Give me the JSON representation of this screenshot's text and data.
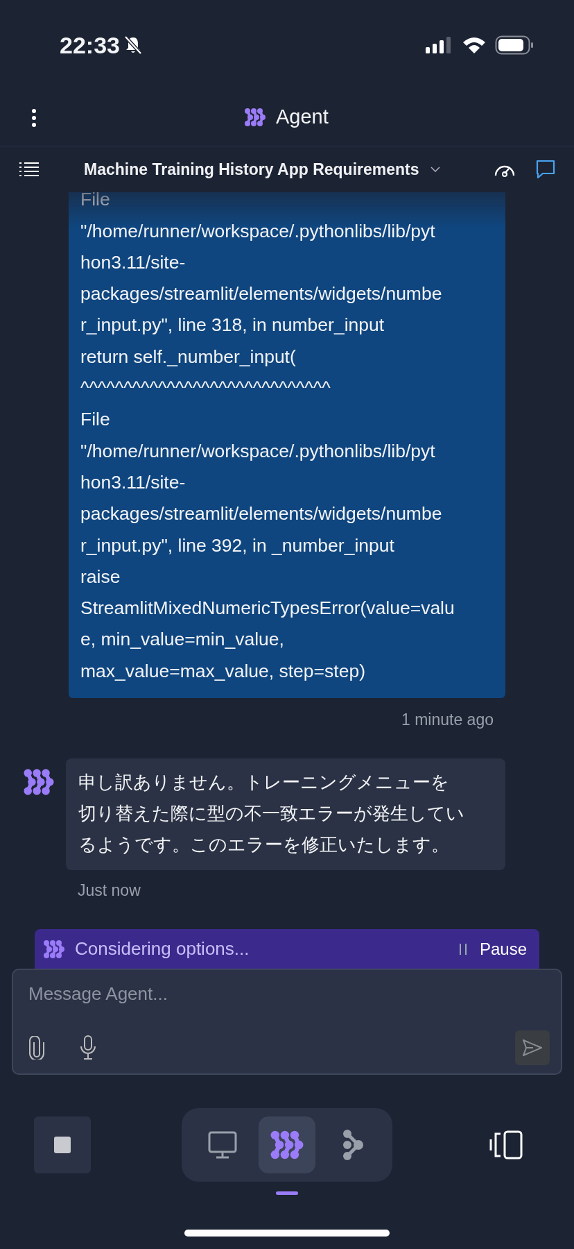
{
  "status_bar": {
    "time": "22:33"
  },
  "header": {
    "title": "Agent"
  },
  "chat": {
    "title": "Machine Training History App Requirements"
  },
  "messages": [
    {
      "kind": "user",
      "lines": [
        "File",
        "\"/home/runner/workspace/.pythonlibs/lib/pyt",
        "hon3.11/site-",
        "packages/streamlit/elements/widgets/numbe",
        "r_input.py\", line 318, in number_input",
        "return self._number_input(",
        "^^^^^^^^^^^^^^^^^^^^^^^^^^^^^",
        "File",
        "\"/home/runner/workspace/.pythonlibs/lib/pyt",
        "hon3.11/site-",
        "packages/streamlit/elements/widgets/numbe",
        "r_input.py\", line 392, in _number_input",
        "raise",
        "StreamlitMixedNumericTypesError(value=valu",
        "e, min_value=min_value,",
        "max_value=max_value, step=step)"
      ],
      "time": "1 minute ago"
    },
    {
      "kind": "agent",
      "text": "申し訳ありません。トレーニングメニューを切り替えた際に型の不一致エラーが発生しているようです。このエラーを修正いたします。",
      "time": "Just now"
    }
  ],
  "progress": {
    "label": "Considering options...",
    "action": "Pause"
  },
  "composer": {
    "placeholder": "Message Agent..."
  },
  "bottom_nav": {
    "tabs": [
      {
        "kind": "preview",
        "selected": false
      },
      {
        "kind": "agent",
        "selected": true
      },
      {
        "kind": "git",
        "selected": false
      }
    ]
  }
}
